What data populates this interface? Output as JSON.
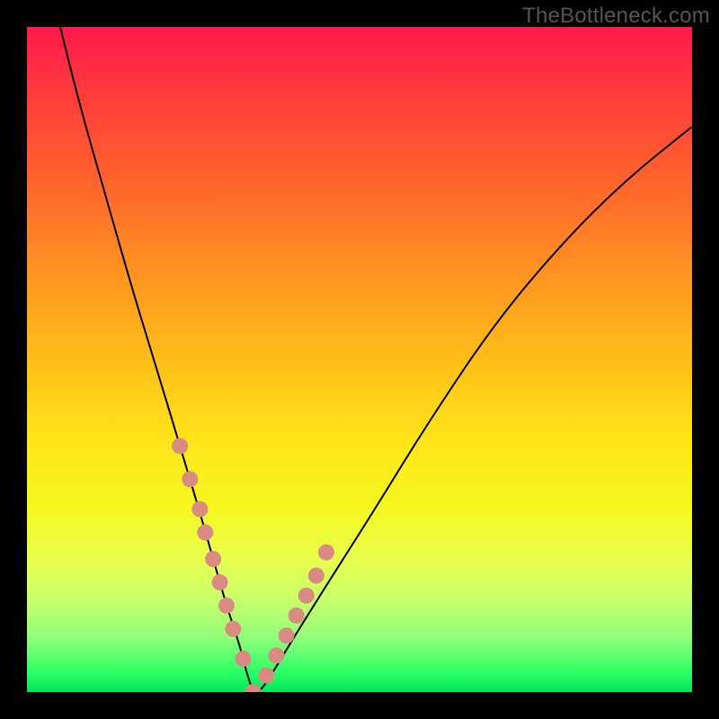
{
  "watermark": "TheBottleneck.com",
  "chart_data": {
    "type": "line",
    "title": "",
    "xlabel": "",
    "ylabel": "",
    "xlim": [
      0,
      100
    ],
    "ylim": [
      0,
      100
    ],
    "series": [
      {
        "name": "bottleneck-curve",
        "x": [
          5,
          8,
          12,
          16,
          20,
          23,
          26,
          28,
          30,
          32,
          33,
          34,
          35,
          37,
          40,
          45,
          52,
          60,
          70,
          80,
          90,
          100
        ],
        "y": [
          100,
          88,
          74,
          60,
          47,
          37,
          27,
          20,
          13,
          7,
          3,
          0,
          0,
          3,
          8,
          16,
          27,
          40,
          55,
          67,
          77,
          85
        ]
      }
    ],
    "markers": {
      "name": "highlighted-points",
      "color": "#d98b82",
      "x": [
        23,
        24.5,
        26,
        26.8,
        28,
        29,
        30,
        31,
        32.5,
        34,
        36,
        37.5,
        39,
        40.5,
        42,
        43.5,
        45
      ],
      "y": [
        37,
        32,
        27.5,
        24,
        20,
        16.5,
        13,
        9.5,
        5,
        0,
        2.5,
        5.5,
        8.5,
        11.5,
        14.5,
        17.5,
        21
      ]
    }
  }
}
